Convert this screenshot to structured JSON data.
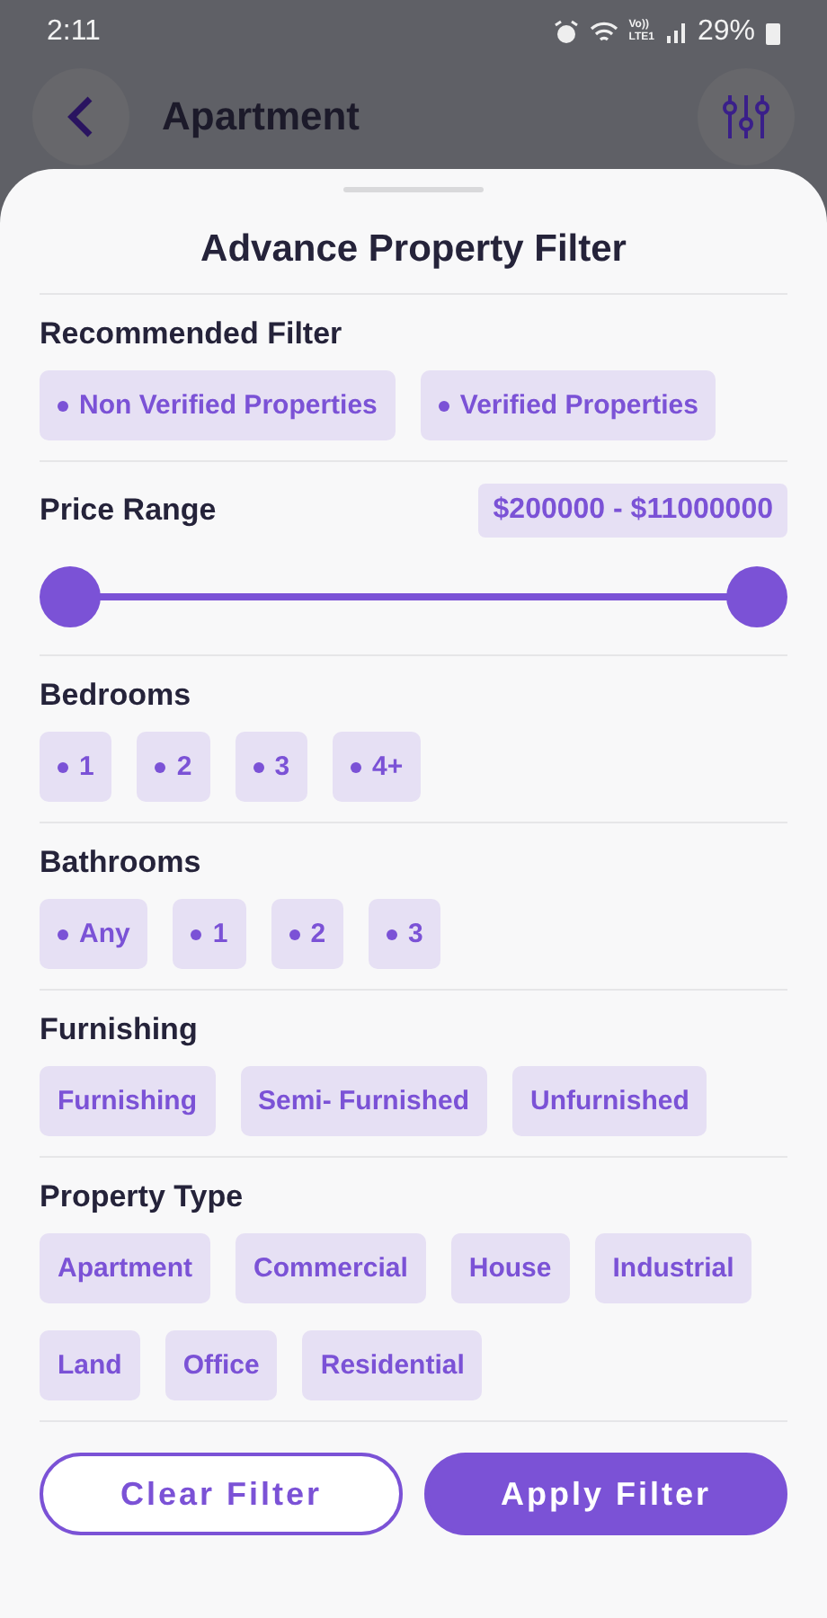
{
  "status_bar": {
    "time": "2:11",
    "network_label": [
      "Vo))",
      "LTE1"
    ],
    "battery": "29%"
  },
  "header": {
    "title": "Apartment"
  },
  "sheet": {
    "title": "Advance Property Filter",
    "sections": [
      {
        "kind": "chips",
        "title": "Recommended Filter",
        "bullet": true,
        "options": [
          {
            "label": "Non Verified Properties",
            "selected": false
          },
          {
            "label": "Verified Properties",
            "selected": false
          }
        ]
      },
      {
        "kind": "range",
        "title": "Price Range",
        "reading": "$200000 - $11000000",
        "thumbs": [
          {
            "level": 0
          },
          {
            "level": 1
          }
        ]
      },
      {
        "kind": "chips",
        "title": "Bedrooms",
        "bullet": true,
        "options": [
          {
            "label": "1",
            "selected": false
          },
          {
            "label": "2",
            "selected": false
          },
          {
            "label": "3",
            "selected": false
          },
          {
            "label": "4+",
            "selected": false
          }
        ]
      },
      {
        "kind": "chips",
        "title": "Bathrooms",
        "bullet": true,
        "options": [
          {
            "label": "Any",
            "selected": false
          },
          {
            "label": "1",
            "selected": false
          },
          {
            "label": "2",
            "selected": false
          },
          {
            "label": "3",
            "selected": false
          }
        ]
      },
      {
        "kind": "chips",
        "title": "Furnishing",
        "bullet": false,
        "options": [
          {
            "label": "Furnishing",
            "selected": false
          },
          {
            "label": "Semi- Furnished",
            "selected": false
          },
          {
            "label": "Unfurnished",
            "selected": false
          }
        ]
      },
      {
        "kind": "chips",
        "title": "Property Type",
        "bullet": false,
        "options": [
          {
            "label": "Apartment",
            "selected": false
          },
          {
            "label": "Commercial",
            "selected": false
          },
          {
            "label": "House",
            "selected": false
          },
          {
            "label": "Industrial",
            "selected": false
          },
          {
            "label": "Land",
            "selected": false
          },
          {
            "label": "Office",
            "selected": false
          },
          {
            "label": "Residential",
            "selected": false
          }
        ]
      }
    ],
    "buttons": {
      "clear": "Clear Filter",
      "apply": "Apply Filter"
    }
  }
}
